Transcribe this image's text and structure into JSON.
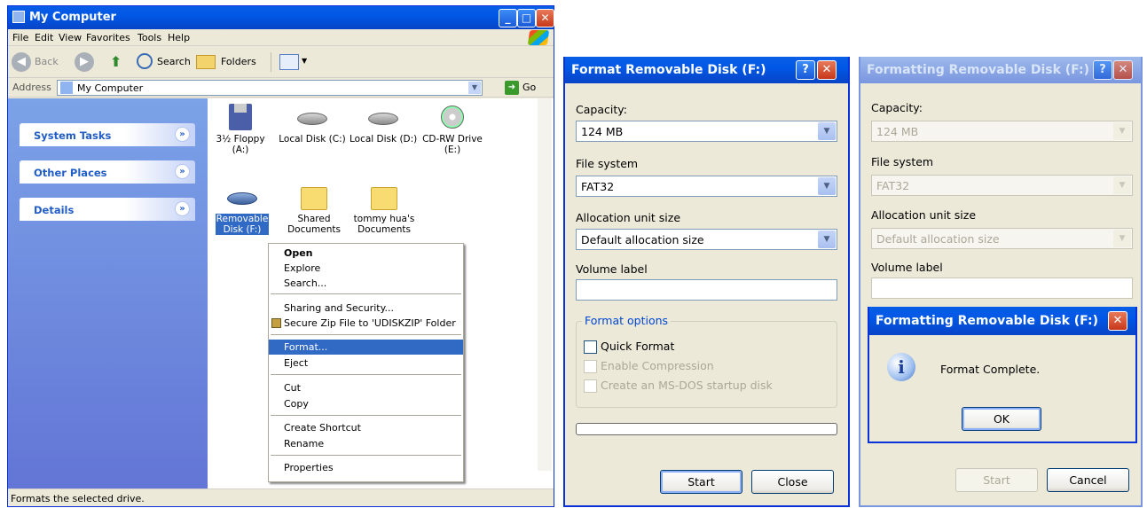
{
  "explorer": {
    "title": "My Computer",
    "menu": [
      "File",
      "Edit",
      "View",
      "Favorites",
      "Tools",
      "Help"
    ],
    "toolbar": {
      "back": "Back",
      "search": "Search",
      "folders": "Folders"
    },
    "address_label": "Address",
    "address_value": "My Computer",
    "go_label": "Go",
    "tasks": [
      "System Tasks",
      "Other Places",
      "Details"
    ],
    "items": [
      {
        "label": "3½ Floppy\n(A:)",
        "icon": "floppy-icon"
      },
      {
        "label": "Local Disk (C:)",
        "icon": "hard-disk-icon"
      },
      {
        "label": "Local Disk (D:)",
        "icon": "hard-disk-icon"
      },
      {
        "label": "CD-RW Drive\n(E:)",
        "icon": "cd-drive-icon"
      },
      {
        "label": "Removable\nDisk (F:)",
        "icon": "removable-disk-icon"
      },
      {
        "label": "Shared\nDocuments",
        "icon": "folder-icon"
      },
      {
        "label": "tommy hua's\nDocuments",
        "icon": "folder-icon"
      }
    ],
    "status": "Formats the selected drive."
  },
  "context_menu": {
    "items": [
      "Open",
      "Explore",
      "Search...",
      "Sharing and Security...",
      "Secure Zip File to 'UDISKZIP' Folder",
      "Format...",
      "Eject",
      "Cut",
      "Copy",
      "Create Shortcut",
      "Rename",
      "Properties"
    ],
    "highlighted": "Format..."
  },
  "format_dialog": {
    "title": "Format Removable Disk (F:)",
    "capacity_label": "Capacity:",
    "capacity_value": "124 MB",
    "fs_label": "File system",
    "fs_value": "FAT32",
    "alloc_label": "Allocation unit size",
    "alloc_value": "Default allocation size",
    "volume_label": "Volume label",
    "options_label": "Format options",
    "quick_format": "Quick Format",
    "enable_compression": "Enable Compression",
    "msdos_disk": "Create an MS-DOS startup disk",
    "start": "Start",
    "close": "Close"
  },
  "formatting_dialog": {
    "title": "Formatting Removable Disk (F:)",
    "capacity_label": "Capacity:",
    "capacity_value": "124 MB",
    "fs_label": "File system",
    "fs_value": "FAT32",
    "alloc_label": "Allocation unit size",
    "alloc_value": "Default allocation size",
    "volume_label": "Volume label",
    "start": "Start",
    "cancel": "Cancel"
  },
  "message_box": {
    "title": "Formatting Removable Disk (F:)",
    "message": "Format Complete.",
    "ok": "OK"
  }
}
